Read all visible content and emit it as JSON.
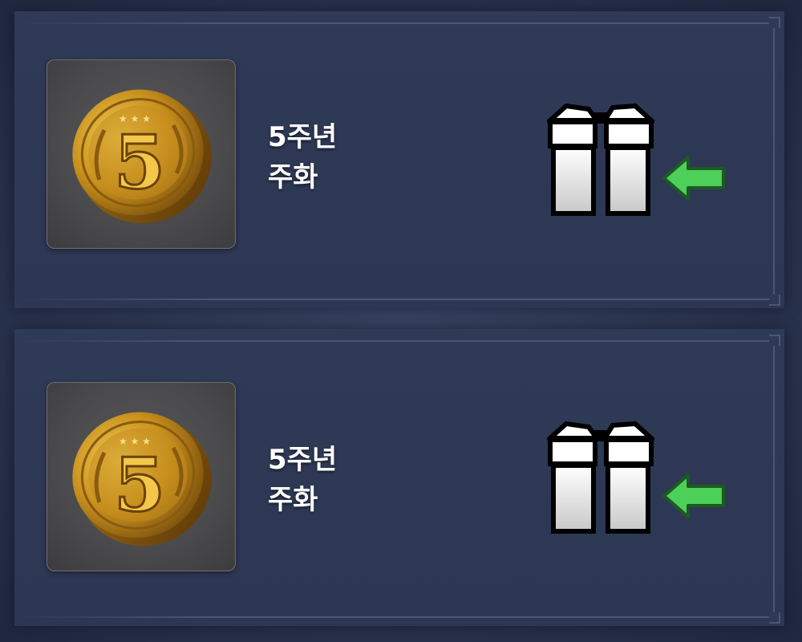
{
  "rewards": [
    {
      "name_line1": "5주년",
      "name_line2": "주화",
      "coin_icon": "gold-coin-5-icon",
      "claim_icon": "gift-box-icon",
      "pointer_icon": "green-arrow-left-icon",
      "arrow_color": "#4cd05a"
    },
    {
      "name_line1": "5주년",
      "name_line2": "주화",
      "coin_icon": "gold-coin-5-icon",
      "claim_icon": "gift-box-icon",
      "pointer_icon": "green-arrow-left-icon",
      "arrow_color": "#4cd05a"
    }
  ],
  "colors": {
    "background": "#2c3550",
    "panel": "#2f3a57",
    "frame": "#4a5676",
    "coin_gold": "#d4a52a",
    "arrow_green": "#4cd05a"
  }
}
